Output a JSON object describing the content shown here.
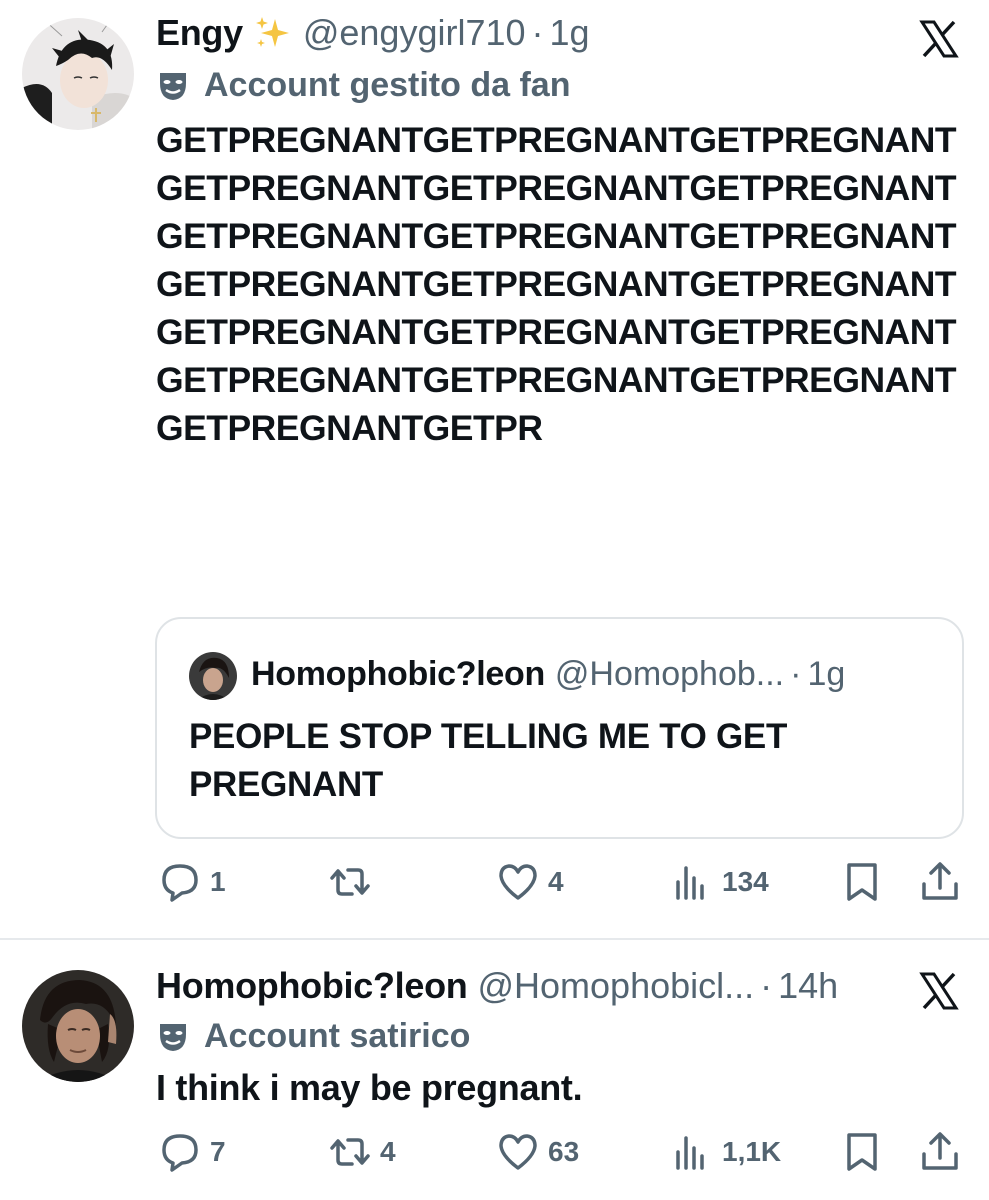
{
  "tweet1": {
    "name": "Engy",
    "handle": "@engygirl710",
    "dot": "·",
    "time": "1g",
    "label": "Account gestito da fan",
    "text": "GETPREGNANTGETPREGNANTGETPREGNANTGETPREGNANTGETPREGNANTGETPREGNANTGETPREGNANTGETPREGNANTGETPREGNANTGETPREGNANTGETPREGNANTGETPREGNANTGETPREGNANTGETPREGNANTGETPREGNANTGETPREGNANTGETPREGNANTGETPREGNANTGETPREGNANTGETPR",
    "quote": {
      "name": "Homophobic?leon",
      "handle": "@Homophob...",
      "dot": "·",
      "time": "1g",
      "text": "PEOPLE STOP TELLING ME TO GET PREGNANT"
    },
    "actions": {
      "replies": "1",
      "reposts": "",
      "likes": "4",
      "views": "134"
    }
  },
  "tweet2": {
    "name": "Homophobic?leon",
    "handle": "@Homophobicl...",
    "dot": "·",
    "time": "14h",
    "label": "Account satirico",
    "text": "I think i may be pregnant.",
    "actions": {
      "replies": "7",
      "reposts": "4",
      "likes": "63",
      "views": "1,1K"
    }
  },
  "icons": [
    "sparkles-icon",
    "x-logo-icon",
    "mask-icon",
    "reply-icon",
    "repost-icon",
    "like-icon",
    "views-icon",
    "bookmark-icon",
    "share-icon"
  ],
  "colors": {
    "text": "#0f1419",
    "secondary": "#536471",
    "border": "#dfe3e6",
    "sparkle": "#f5c542"
  }
}
